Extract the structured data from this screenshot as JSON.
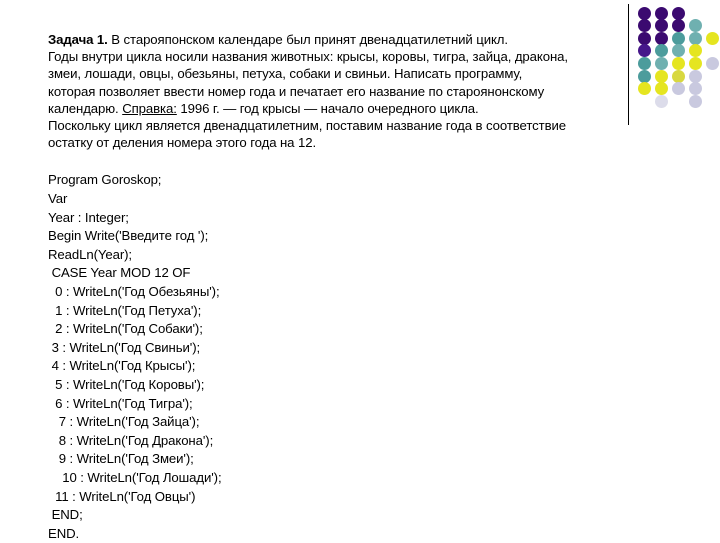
{
  "slide": {
    "background_color": "#ffffff",
    "text_color": "#000000"
  },
  "problem": {
    "lead": "Задача 1.",
    "lines": [
      " В старояпонском календаре был принят двенадцатилетний цикл.",
      "Годы внутри цикла носили названия животных: крысы, коровы, тигра, зайца, дракона,",
      "змеи, лошади, овцы, обезьяны, петуха, собаки и свиньи. Написать программу,",
      "которая позволяет ввести номер года и печатает его название по староянонскому"
    ],
    "line_with_ref_prefix": "календарю. ",
    "ref_label": "Справка:",
    "line_with_ref_suffix": " 1996 г. — год крысы — начало очередного цикла.",
    "tail_lines": [
      "Поскольку цикл является двенадцатилетним, поставим название года в соответствие",
      "остатку от деления номера этого года на 12."
    ]
  },
  "code": {
    "lines": [
      "Program Goroskop;",
      "Var",
      "Year : Integer;",
      "Begin Write('Введите год ');",
      "ReadLn(Year);",
      " CASE Year MOD 12 OF",
      "  0 : WriteLn('Год Обезьяны');",
      "  1 : WriteLn('Год Петуха');",
      "  2 : WriteLn('Год Собаки');",
      " 3 : WriteLn('Год Свиньи');",
      " 4 : WriteLn('Год Крысы');",
      "  5 : WriteLn('Год Коровы');",
      "  6 : WriteLn('Год Тигра');",
      "   7 : WriteLn('Год Зайца');",
      "   8 : WriteLn('Год Дракона');",
      "   9 : WriteLn('Год Змеи');",
      "    10 : WriteLn('Год Лошади');",
      "  11 : WriteLn('Год Овцы')",
      " END;",
      "END."
    ]
  },
  "decoration": {
    "name": "diagonal-dot-gradient",
    "divider_color": "#000000",
    "columns": 5,
    "rows": 9,
    "palette": {
      "deep_purple": "#3B0A70",
      "purple": "#46168A",
      "teal": "#4C9C9C",
      "teal_light": "#6FB0B0",
      "yellow": "#E5E520",
      "yellow_soft": "#D8D840",
      "lavender": "#C9C9DF",
      "lavender_pale": "#DCDCEA",
      "none": "transparent"
    },
    "grid": [
      [
        "deep_purple",
        "deep_purple",
        "deep_purple",
        "none",
        "none"
      ],
      [
        "deep_purple",
        "deep_purple",
        "deep_purple",
        "teal_light",
        "none"
      ],
      [
        "deep_purple",
        "deep_purple",
        "teal",
        "teal_light",
        "yellow"
      ],
      [
        "purple",
        "teal",
        "teal_light",
        "yellow",
        "none"
      ],
      [
        "teal",
        "teal_light",
        "yellow",
        "yellow",
        "lavender"
      ],
      [
        "teal",
        "yellow",
        "yellow_soft",
        "lavender",
        "none"
      ],
      [
        "yellow",
        "yellow",
        "lavender",
        "lavender",
        "none"
      ],
      [
        "none",
        "lavender_pale",
        "none",
        "lavender",
        "none"
      ],
      [
        "none",
        "none",
        "none",
        "none",
        "none"
      ]
    ]
  }
}
